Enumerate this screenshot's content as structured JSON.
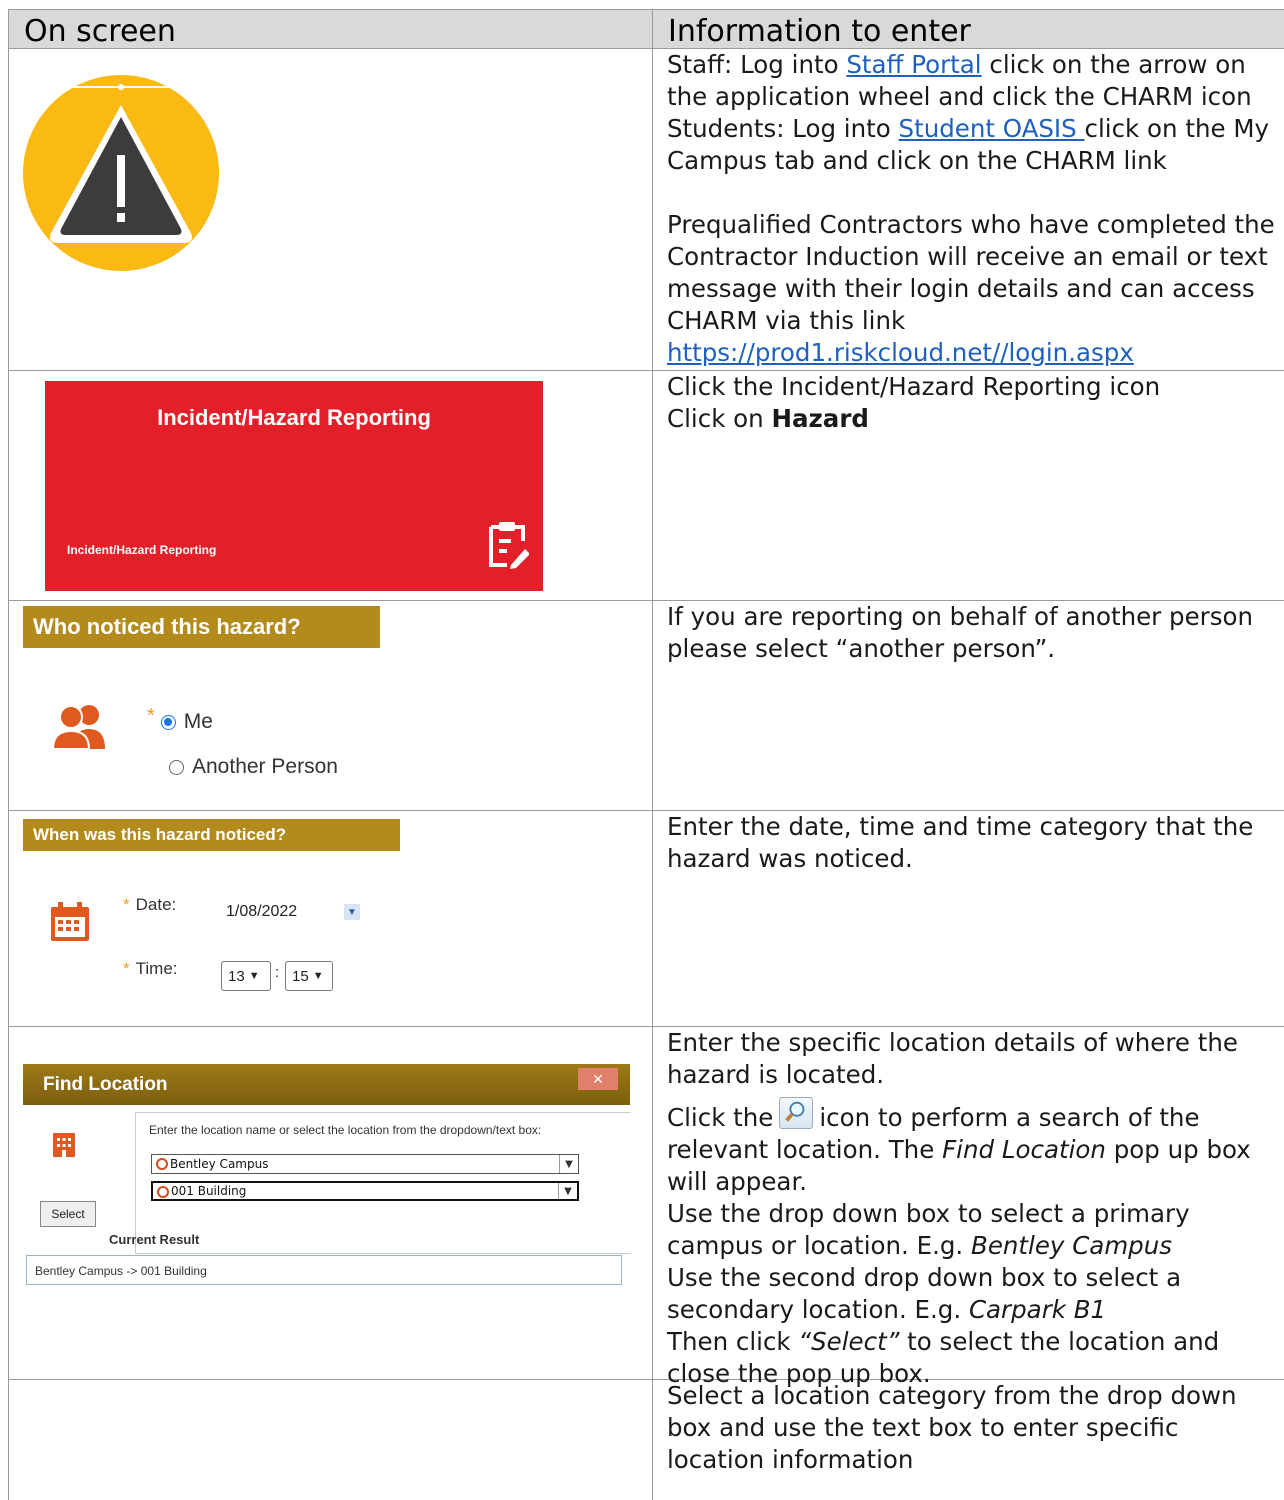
{
  "header": {
    "col1": "On screen",
    "col2": "Information to enter"
  },
  "row1": {
    "line1_pre": "Staff: Log into ",
    "line1_link": "Staff Portal",
    "line1_post": " click on the arrow on the application wheel and click the CHARM icon",
    "line2_pre": "Students: Log into ",
    "line2_link": "Student OASIS ",
    "line2_post": " click on the My Campus tab and click on the CHARM link",
    "para2": "Prequalified Contractors who have completed the Contractor Induction will receive an email or text message with their login details and can access CHARM via this link",
    "url": "https://prod1.riskcloud.net//login.aspx",
    "icon": "warning-icon"
  },
  "row2": {
    "card_title": "Incident/Hazard Reporting",
    "card_subtitle": "Incident/Hazard Reporting",
    "line1": "Click the Incident/Hazard Reporting icon",
    "line2_pre": "Click on ",
    "line2_bold": "Hazard",
    "card_color": "#e31f2a"
  },
  "row3": {
    "bar_title": "Who noticed this hazard?",
    "star": "*",
    "opt_me": "Me",
    "opt_other": "Another Person",
    "text": "If you are reporting on behalf of another person please select “another person”.",
    "bar_color": "#b38b1c"
  },
  "row4": {
    "bar_title": "When was this hazard noticed?",
    "date_label": "Date:",
    "date_value": "1/08/2022",
    "time_label": "Time:",
    "hour": "13",
    "minute": "15",
    "colon": ":",
    "text": "Enter the date, time and time category that the hazard was noticed."
  },
  "row5": {
    "dlg_title": "Find Location",
    "close": "✕",
    "instruction": "Enter the location name or select the location from the dropdown/text box:",
    "dd1": "Bentley Campus",
    "dd2": "001 Building",
    "select_btn": "Select",
    "current_label": "Current Result",
    "current_value": "Bentley Campus -> 001 Building",
    "p1": "Enter the specific location details of where the hazard is located.",
    "p2_pre": "Click the",
    "p2_post": "icon to perform a search of the relevant location. The ",
    "p2_ital": "Find Location",
    "p2_end": " pop up box will appear.",
    "p3_pre": "Use the drop down box to select a primary campus or location. E.g. ",
    "p3_ital": "Bentley Campus",
    "p4_pre": "Use the second drop down box to select a secondary location. E.g. ",
    "p4_ital": "Carpark B1",
    "p5_pre": "Then click ",
    "p5_ital": "“Select”",
    "p5_post": " to select the location and close the pop up box."
  },
  "row6": {
    "text": "Select a location category from the drop down box and use the text box to enter specific location information"
  }
}
